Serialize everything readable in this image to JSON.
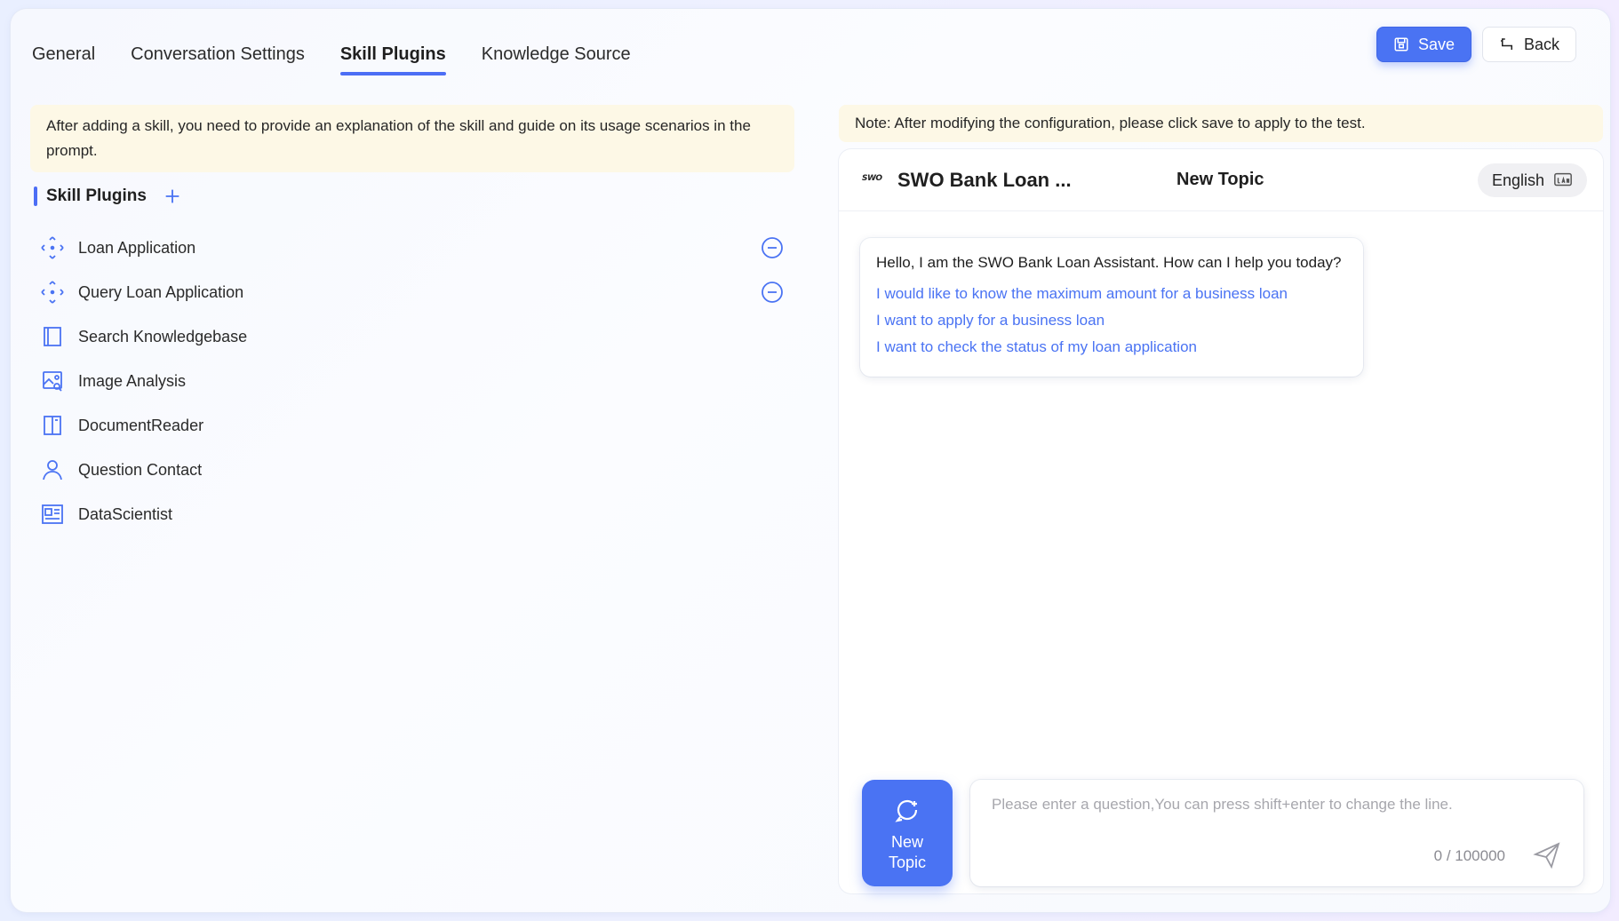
{
  "tabs": [
    {
      "label": "General",
      "active": false
    },
    {
      "label": "Conversation Settings",
      "active": false
    },
    {
      "label": "Skill Plugins",
      "active": true
    },
    {
      "label": "Knowledge Source",
      "active": false
    }
  ],
  "toolbar": {
    "save_label": "Save",
    "back_label": "Back"
  },
  "left": {
    "notice": "After adding a skill, you need to provide an explanation of the skill and guide on its usage scenarios in the prompt.",
    "section_title": "Skill Plugins",
    "plugins": [
      {
        "label": "Loan Application",
        "icon": "api-diamond-icon",
        "removable": true
      },
      {
        "label": "Query Loan Application",
        "icon": "api-diamond-icon",
        "removable": true
      },
      {
        "label": "Search Knowledgebase",
        "icon": "book-icon",
        "removable": false
      },
      {
        "label": "Image Analysis",
        "icon": "image-search-icon",
        "removable": false
      },
      {
        "label": "DocumentReader",
        "icon": "document-icon",
        "removable": false
      },
      {
        "label": "Question Contact",
        "icon": "user-icon",
        "removable": false
      },
      {
        "label": "DataScientist",
        "icon": "dashboard-icon",
        "removable": false
      }
    ]
  },
  "right": {
    "note": "Note: After modifying the configuration, please click save to apply to the test.",
    "chat": {
      "logo_text": "SWO",
      "bot_name": "SWO Bank Loan ...",
      "topic_title": "New Topic",
      "language": "English",
      "greeting": "Hello, I am the SWO Bank Loan Assistant. How can I help you today?",
      "suggestions": [
        "I would like to know the maximum amount for a business loan",
        "I want to apply for a business loan",
        "I want to check the status of my loan application"
      ],
      "new_topic_line1": "New",
      "new_topic_line2": "Topic",
      "input_placeholder": "Please enter a question,You can press shift+enter to change the line.",
      "counter": "0 / 100000"
    }
  },
  "colors": {
    "accent": "#4a73f3",
    "notice_bg": "#fdf8e6",
    "link": "#4a73f3"
  }
}
